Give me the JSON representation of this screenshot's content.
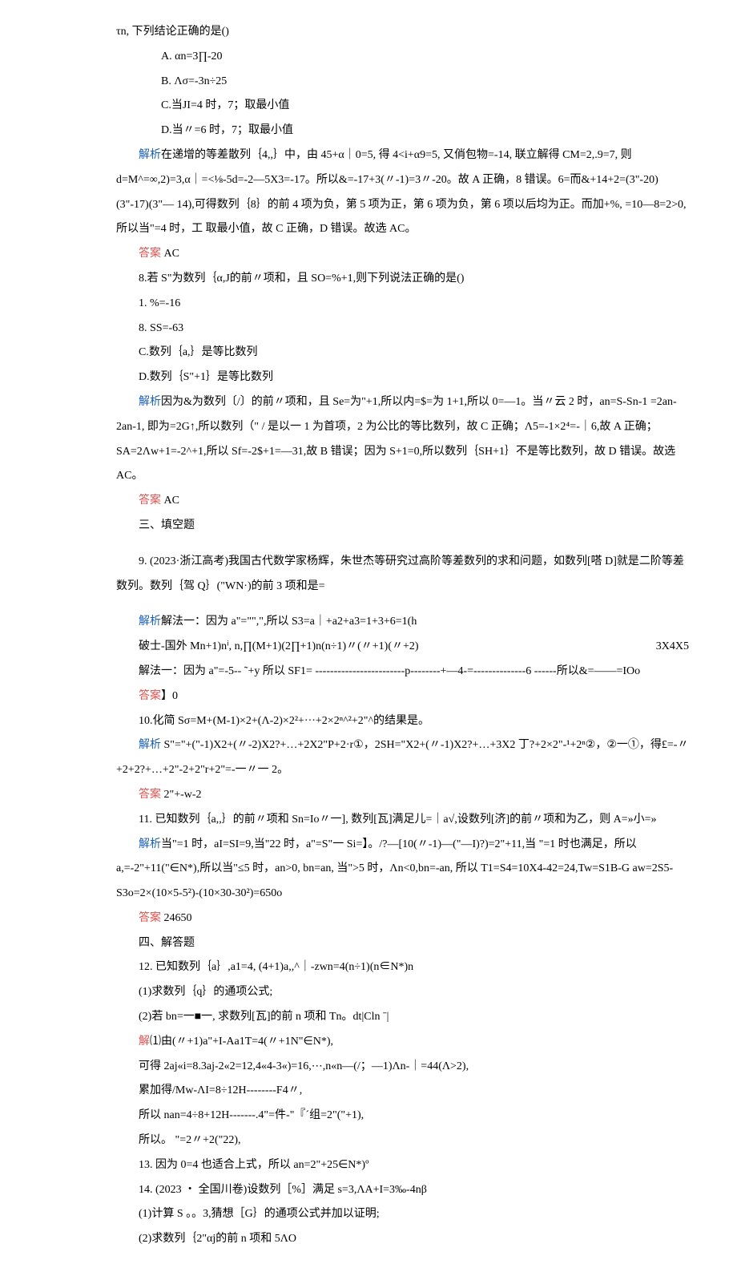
{
  "p": [
    "τn, 下列结论正确的是()",
    "A.   αn=3∏-20",
    "B.   Λσ=-3n÷25",
    "C.当JI=4 时，7；取最小值",
    "D.当〃=6 时，7；取最小值",
    "解析",
    "在递增的等差散列｛4,,｝中，由 45+α｜0=5, 得 4<i+α9=5, 又俏包物=-14, 联立解得 CM=2,.9=7, 则d=M^=∞,2)=3,α｜=<⅛-5d=-2—5X3=-17。所以&=-17+3(〃-1)=3〃-20。故 A 正确，8 错误。6=而&+14+2=(3\"-20)(3\"-17)(3\"— 14),可得数列｛8｝的前 4 项为负，第 5 项为正，第 6 项为负，第 6 项以后均为正。而加+%, =10—8=2>0,所以当\"=4 时，工 取最小值，故 C 正确，D 错误。故选 AC。",
    "答案",
    "AC",
    "8.若 S\"为数列｛α,J的前〃项和，且 SO=%+1,则下列说法正确的是()",
    "1.   %=-16",
    "8.   SS=-63",
    "C.数列｛a,｝是等比数列",
    "D.数列｛S\"+1｝是等比数列",
    "解析",
    "因为&为数列〔/〕的前〃项和，且 Se=为\"+1,所以内=$=为 1+1,所以 0=—1。当〃云 2 时，an=S-Sn-1 =2an-2an-1, 即为=2G↑,所以数列（\" / 是以一 1 为首项，2 为公比的等比数列，故 C 正确；Λ5=-1×2⁴=-｜6,故 A 正确；SA=2Λw+1=-2^+1,所以 Sf=-2$+1=—31,故 B 错误；因为 S+1=0,所以数列｛SH+1｝不是等比数列，故 D 错误。故选 AC。",
    "答案",
    "AC",
    "三、填空题",
    "9.   (2023·浙江高考)我国古代数学家杨辉，朱世杰等研究过高阶等差数列的求和问题，如数列[嗒 D]就是二阶等差数列。数列｛驾 Q｝(\"WN·)的前 3 项和是=",
    "解析",
    "解法一：因为 a\"=\"\",\",所以 S3=a｜+a2+a3=1+3+6=1(h",
    "破士-国外 Mn+1)nⁱ, n,∏(M+1)(2∏+1)n(n÷1)〃(〃+1)(〃+2)",
    "3X4X5",
    "解法一：因为 a\"=-5-- ˜+y 所以 SF1= ------------------------p--------+—4-=--------------6 ------所以&=——=IOo",
    "答案",
    "】0",
    "10.化简 Sσ=M+(M-1)×2+(Λ-2)×2²+···+2×2ⁿ^²+2\"^的结果是。",
    "解析",
    "S\"=\"+(\"-1)X2+(〃-2)X2?+…+2X2\"P+2·r①，2SH=\"X2+(〃-1)X2?+…+3X2 丁?+2×2\"-¹+2ⁿ②，②一①，得£=-〃+2+2?+…+2\"-2+2\"r+2\"=-一〃一 2。",
    "答案",
    "2\"+-w-2",
    "11.   已知数列｛a,,｝的前〃项和 Sn=Io〃一], 数列[瓦]满足儿=｜a√,设数列[济]的前〃项和为乙，则 A=»小=»",
    "解析",
    "当\"=1 时，aI=SI=9,当\"22 时，a\"=S\"一 Si=】。/?—[10(〃-1)—(\"—I)?)=2\"+11,当 \"=1 时也满足，所以a,=-2\"+11(\"∈N*),所以当\"≤5 时，an>0, bn=an, 当\">5 时，Λn<0,bn=-an, 所以 T1=S4=10X4-42=24,Tw=S1B-G aw=2S5-S3o=2×(10×5-5²)-(10×30-30²)=650o",
    "答案",
    "24650",
    "四、解答题",
    "12.   已知数列｛a｝,a1=4, (4+1)a,,^｜-zwn=4(n÷1)(n∈N*)n",
    "(1)求数列｛q｝的通项公式;",
    "(2)若 bn=一■一, 求数列[瓦]的前 n 项和 Tn。dt|Cln ˉ|",
    "解",
    "⑴由(〃+1)a\"+I-Aa1T=4(〃+1N\"∈N*),",
    "可得 2aj«i=8.3aj-2«2=12,4«4-3«)=16,⋯,n«n—(/；—1)Λn-｜=44(Λ>2),",
    "累加得/Mw-ΛI=8÷12H--------F4〃,",
    "所以 nan=4÷8+12H-------.4\"=件-\"『´组=2\"(\"+1),",
    "所以。 \"=2〃+2(\"22),",
    "13.   因为 0=4 也适合上式，所以 an=2\"+25∈N*)º",
    "14.   (2023 ・ 全国川卷)设数列［%］满足 s=3,ΛA+I=3‰-4nβ",
    "(1)计算 S 。。3,猜想［G｝的通项公式并加以证明;",
    "(2)求数列｛2\"αj的前 n 项和 5ΛO"
  ]
}
